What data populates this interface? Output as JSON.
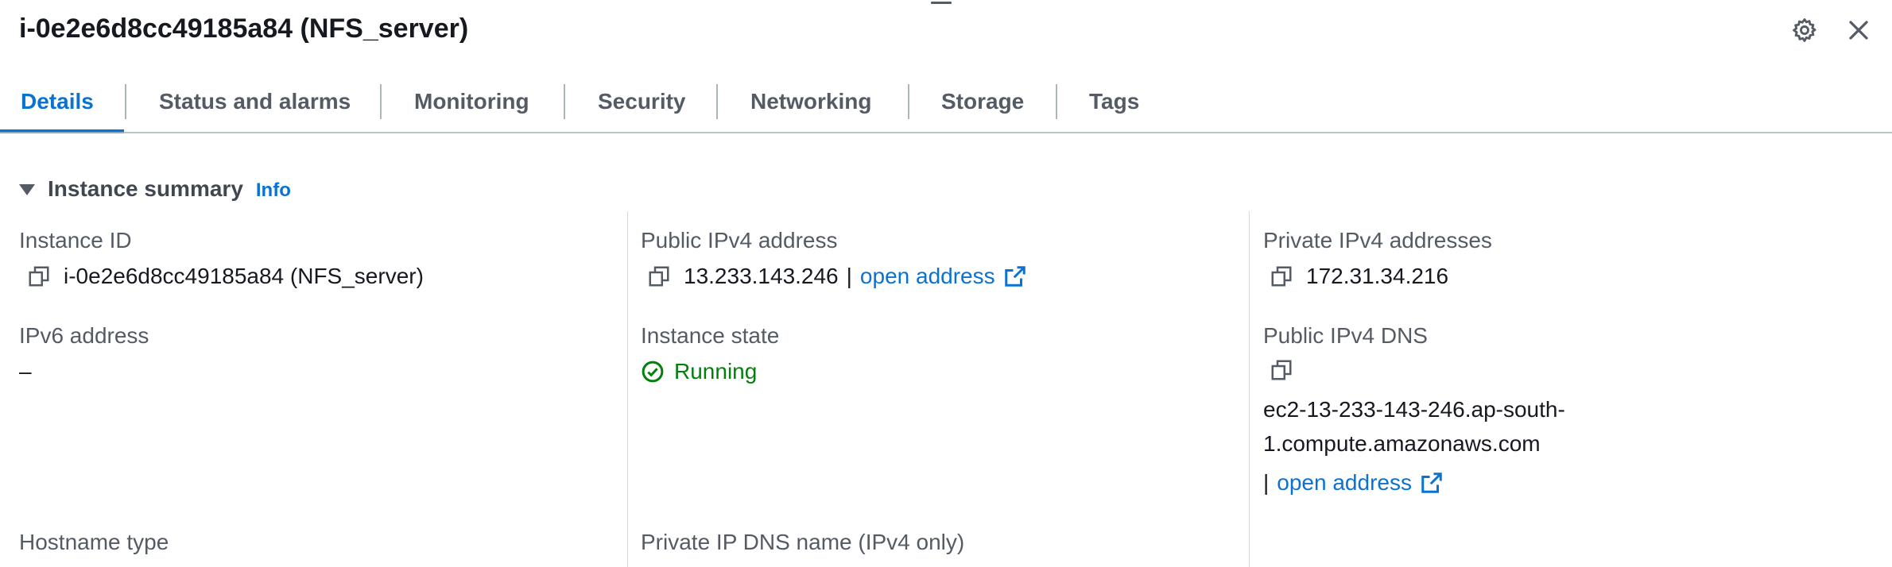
{
  "header": {
    "title": "i-0e2e6d8cc49185a84 (NFS_server)"
  },
  "tabs": [
    {
      "label": "Details"
    },
    {
      "label": "Status and alarms"
    },
    {
      "label": "Monitoring"
    },
    {
      "label": "Security"
    },
    {
      "label": "Networking"
    },
    {
      "label": "Storage"
    },
    {
      "label": "Tags"
    }
  ],
  "summary": {
    "title": "Instance summary",
    "info": "Info"
  },
  "fields": {
    "instance_id": {
      "label": "Instance ID",
      "value": "i-0e2e6d8cc49185a84 (NFS_server)"
    },
    "public_ipv4": {
      "label": "Public IPv4 address",
      "value": "13.233.143.246",
      "separator": "|",
      "link": "open address"
    },
    "private_ipv4": {
      "label": "Private IPv4 addresses",
      "value": "172.31.34.216"
    },
    "ipv6": {
      "label": "IPv6 address",
      "value": "–"
    },
    "instance_state": {
      "label": "Instance state",
      "value": "Running"
    },
    "public_dns": {
      "label": "Public IPv4 DNS",
      "line1": "ec2-13-233-143-246.ap-south-",
      "line2": "1.compute.amazonaws.com",
      "separator": "|",
      "link": "open address"
    },
    "hostname_type": {
      "label": "Hostname type"
    },
    "private_dns": {
      "label": "Private IP DNS name (IPv4 only)"
    }
  },
  "colors": {
    "accent": "#0972d3",
    "running": "#037f0c",
    "text": "#16191f",
    "muted": "#545b64"
  },
  "icons": {
    "settings": "gear-icon",
    "close": "close-icon",
    "copy": "copy-icon",
    "external": "external-link-icon",
    "status": "check-circle-icon"
  }
}
